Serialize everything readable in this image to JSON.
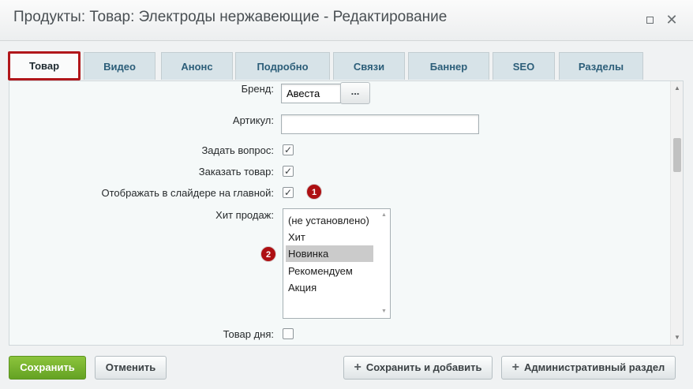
{
  "window": {
    "title": "Продукты: Товар: Электроды нержавеющие - Редактирование",
    "close_glyph": "✕"
  },
  "tabs": [
    {
      "label": "Товар",
      "active": true
    },
    {
      "label": "Видео"
    },
    {
      "label": "Анонс"
    },
    {
      "label": "Подробно"
    },
    {
      "label": "Связи"
    },
    {
      "label": "Баннер"
    },
    {
      "label": "SEO"
    },
    {
      "label": "Разделы"
    }
  ],
  "form": {
    "brand": {
      "label": "Бренд:",
      "value": "Авеста",
      "browse_label": "..."
    },
    "article": {
      "label": "Артикул:",
      "value": ""
    },
    "ask_question": {
      "label": "Задать вопрос:",
      "checked": true
    },
    "order_product": {
      "label": "Заказать товар:",
      "checked": true
    },
    "show_in_slider": {
      "label": "Отображать в слайдере на главной:",
      "checked": true
    },
    "bestseller": {
      "label": "Хит продаж:",
      "options": [
        "(не установлено)",
        "Хит",
        "Новинка",
        "Рекомендуем",
        "Акция"
      ],
      "selected": "Новинка"
    },
    "product_of_day": {
      "label": "Товар дня:",
      "checked": false
    }
  },
  "checkmark_glyph": "✓",
  "badges": [
    "1",
    "2"
  ],
  "buttons": {
    "save": "Сохранить",
    "cancel": "Отменить",
    "save_and_add": "Сохранить и добавить",
    "admin_section": "Административный раздел"
  },
  "icons": {
    "maximize": "maximize-icon",
    "close": "close-icon",
    "plus": "plus-icon",
    "check": "check-icon",
    "scroll_up": "scroll-up-arrow-icon",
    "scroll_down": "scroll-down-arrow-icon"
  },
  "colors": {
    "active_tab_border": "#b1171b",
    "tab_bg": "#d7e3e8",
    "tab_text": "#2c5e79",
    "save_button": "#64a223",
    "badge": "#ad0f12",
    "selected_option": "#cbcbcb"
  }
}
